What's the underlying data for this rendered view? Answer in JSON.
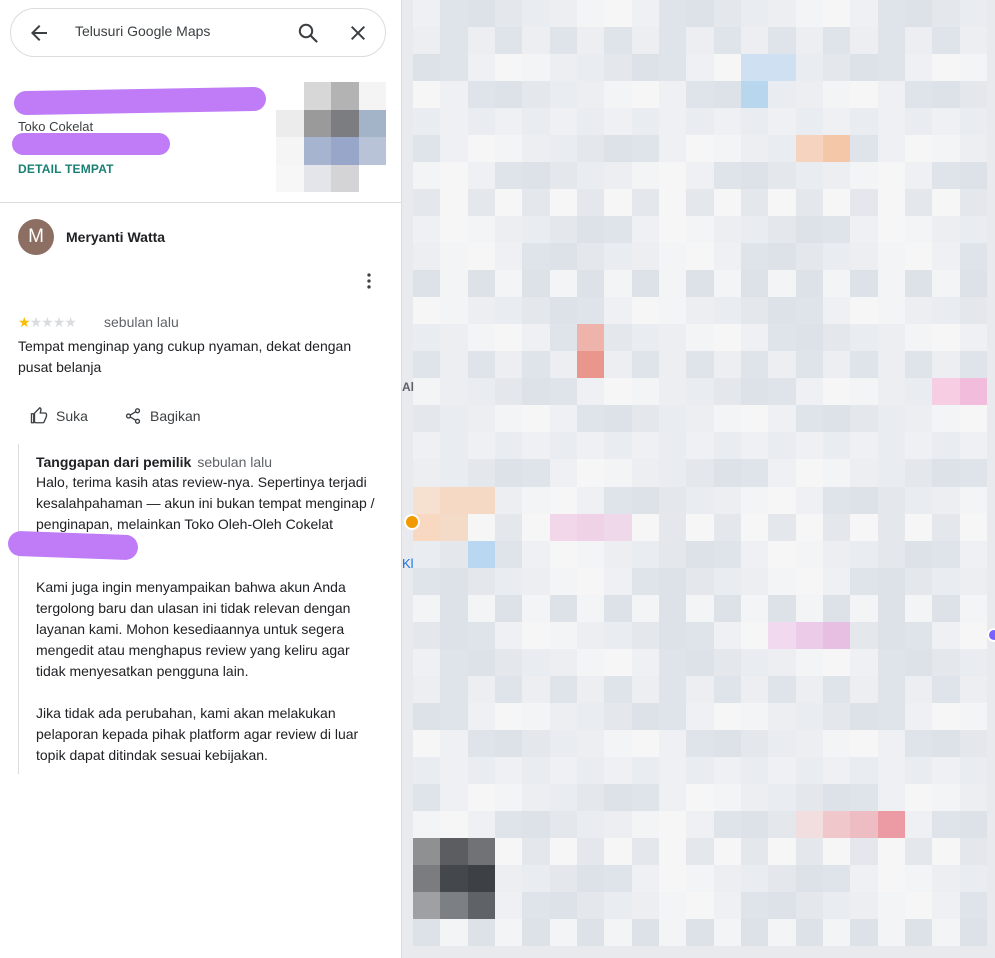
{
  "search": {
    "placeholder": "Telusuri Google Maps"
  },
  "place": {
    "name": "Toko Cokelat",
    "detail_link": "DETAIL TEMPAT"
  },
  "review": {
    "avatar_initial": "M",
    "reviewer_name": "Meryanti Watta",
    "rating": 1,
    "rating_max": 5,
    "date": "sebulan lalu",
    "text": "Tempat menginap yang cukup nyaman, dekat dengan pusat belanja",
    "actions": {
      "like": "Suka",
      "share": "Bagikan"
    }
  },
  "owner_response": {
    "label": "Tanggapan dari pemilik",
    "date": "sebulan lalu",
    "paragraph1": "Halo, terima kasih atas review-nya. Sepertinya terjadi kesalahpahaman — akun ini bukan tempat menginap / penginapan, melainkan Toko Oleh-Oleh Cokelat",
    "paragraph2": "Kami juga ingin menyampaikan bahwa akun Anda tergolong baru dan ulasan ini tidak relevan dengan layanan kami. Mohon kesediaannya untuk segera mengedit atau menghapus review yang keliru agar tidak menyesatkan pengguna lain.",
    "paragraph3": "Jika tidak ada perubahan, kami akan melakukan pelaporan kepada pihak platform agar review di luar topik dapat ditindak sesuai kebijakan."
  },
  "colors": {
    "accent_link": "#1a7f75",
    "star": "#fbbc04",
    "redaction": "#bf7cf6",
    "avatar": "#8d6e63"
  }
}
